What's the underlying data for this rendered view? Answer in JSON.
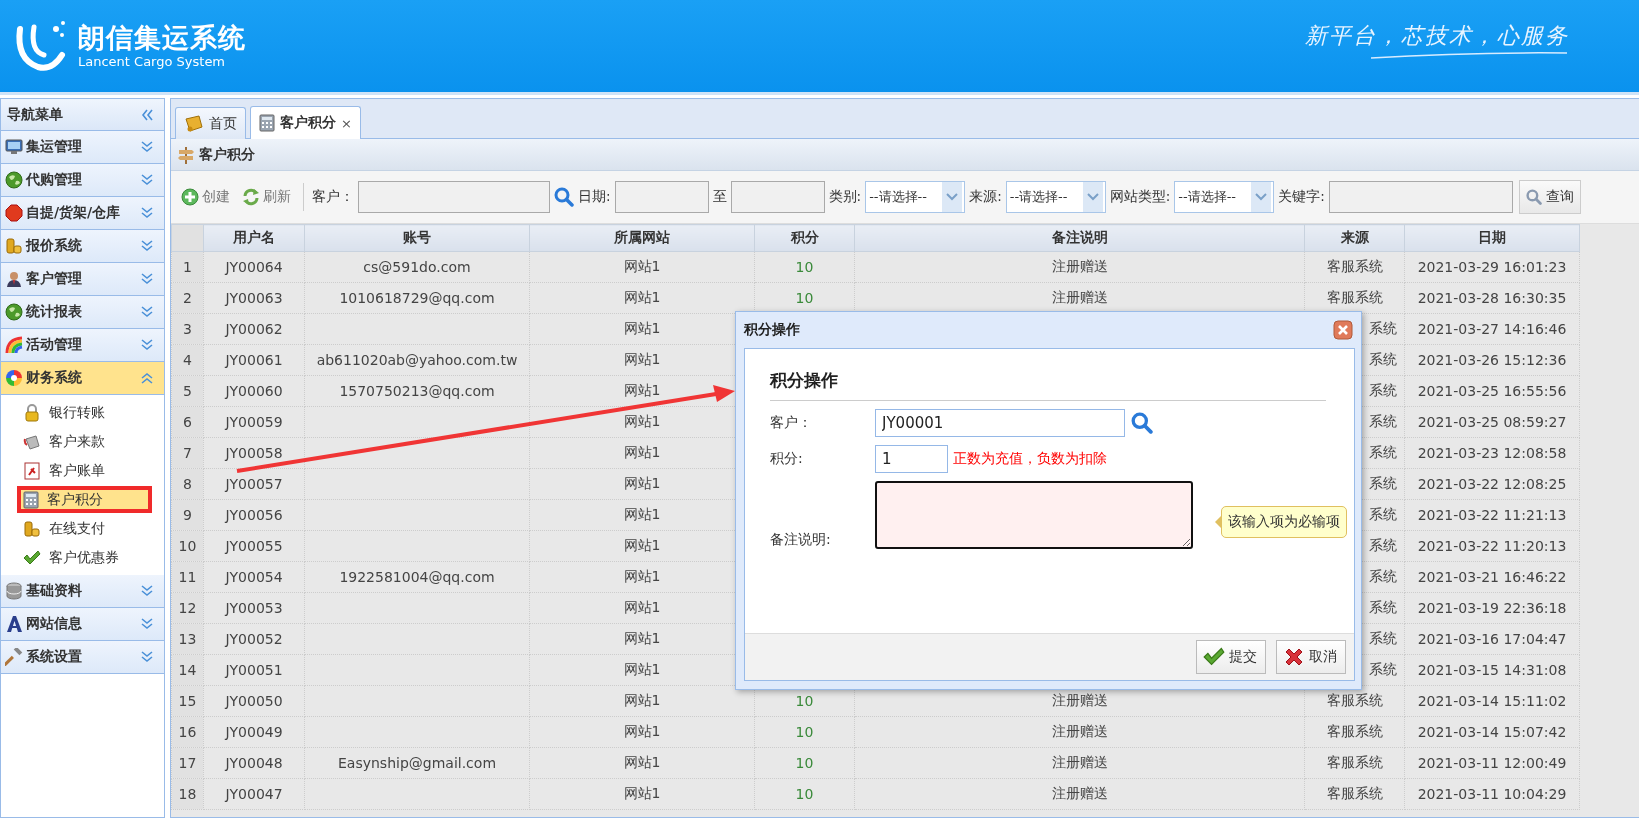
{
  "header": {
    "title": "朗信集运系统",
    "subtitle": "Lancent Cargo System",
    "slogan": "新平台，芯技术，心服务"
  },
  "sidebar": {
    "title": "导航菜单",
    "groups": [
      {
        "label": "集运管理",
        "expanded": false
      },
      {
        "label": "代购管理",
        "expanded": false
      },
      {
        "label": "自提/货架/仓库",
        "expanded": false
      },
      {
        "label": "报价系统",
        "expanded": false
      },
      {
        "label": "客户管理",
        "expanded": false
      },
      {
        "label": "统计报表",
        "expanded": false
      },
      {
        "label": "活动管理",
        "expanded": false
      },
      {
        "label": "财务系统",
        "expanded": true,
        "children": [
          {
            "label": "银行转账",
            "selected": false,
            "highlighted": false
          },
          {
            "label": "客户来款",
            "selected": false,
            "highlighted": false
          },
          {
            "label": "客户账单",
            "selected": false,
            "highlighted": false
          },
          {
            "label": "客户积分",
            "selected": true,
            "highlighted": true
          },
          {
            "label": "在线支付",
            "selected": false,
            "highlighted": false
          },
          {
            "label": "客户优惠券",
            "selected": false,
            "highlighted": false
          }
        ]
      },
      {
        "label": "基础资料",
        "expanded": false
      },
      {
        "label": "网站信息",
        "expanded": false
      },
      {
        "label": "系统设置",
        "expanded": false
      }
    ]
  },
  "tabs": [
    {
      "label": "首页",
      "selected": false
    },
    {
      "label": "客户积分",
      "selected": true,
      "close": "×"
    }
  ],
  "panel": {
    "title": "客户积分"
  },
  "toolbar": {
    "buttons": [
      {
        "label": "创建"
      },
      {
        "label": "刷新"
      }
    ],
    "filters": [
      {
        "kind": "field",
        "label": "客户：",
        "lookup": true
      },
      {
        "kind": "field",
        "label": "日期:",
        "lookup": false
      },
      {
        "kind": "field",
        "label": "至",
        "lookup": false
      },
      {
        "kind": "select",
        "label": "类别:",
        "value": "--请选择--"
      },
      {
        "kind": "select",
        "label": "来源:",
        "value": "--请选择--"
      },
      {
        "kind": "select",
        "label": "网站类型:",
        "value": "--请选择--"
      },
      {
        "kind": "field",
        "label": "关键字:",
        "lookup": false
      }
    ],
    "search_button": {
      "label": "查询"
    }
  },
  "table": {
    "columns": [
      "用户名",
      "账号",
      "所属网站",
      "积分",
      "备注说明",
      "来源",
      "日期"
    ],
    "rows": [
      {
        "no": "1",
        "user": "JY00064",
        "account": "cs@591do.com",
        "site": "网站1",
        "score": "10",
        "note": "注册赠送",
        "source": "客服系统",
        "date": "2021-03-29 16:01:23"
      },
      {
        "no": "2",
        "user": "JY00063",
        "account": "1010618729@qq.com",
        "site": "网站1",
        "score": "10",
        "note": "注册赠送",
        "source": "客服系统",
        "date": "2021-03-28 16:30:35"
      },
      {
        "no": "3",
        "user": "JY00062",
        "site": "网站1",
        "source": "系统",
        "date": "2021-03-27 14:16:46"
      },
      {
        "no": "4",
        "user": "JY00061",
        "account": "ab611020ab@yahoo.com.tw",
        "site": "网站1",
        "source": "系统",
        "date": "2021-03-26 15:12:36"
      },
      {
        "no": "5",
        "user": "JY00060",
        "account": "1570750213@qq.com",
        "site": "网站1",
        "source": "系统",
        "date": "2021-03-25 16:55:56"
      },
      {
        "no": "6",
        "user": "JY00059",
        "site": "网站1",
        "source": "系统",
        "date": "2021-03-25 08:59:27"
      },
      {
        "no": "7",
        "user": "JY00058",
        "site": "网站1",
        "source": "系统",
        "date": "2021-03-23 12:08:58"
      },
      {
        "no": "8",
        "user": "JY00057",
        "site": "网站1",
        "source": "系统",
        "date": "2021-03-22 12:08:25"
      },
      {
        "no": "9",
        "user": "JY00056",
        "site": "网站1",
        "source": "系统",
        "date": "2021-03-22 11:21:13"
      },
      {
        "no": "10",
        "user": "JY00055",
        "site": "网站1",
        "source": "系统",
        "date": "2021-03-22 11:20:13"
      },
      {
        "no": "11",
        "user": "JY00054",
        "account": "1922581004@qq.com",
        "site": "网站1",
        "source": "系统",
        "date": "2021-03-21 16:46:22"
      },
      {
        "no": "12",
        "user": "JY00053",
        "site": "网站1",
        "source": "系统",
        "date": "2021-03-19 22:36:18"
      },
      {
        "no": "13",
        "user": "JY00052",
        "site": "网站1",
        "source": "系统",
        "date": "2021-03-16 17:04:47"
      },
      {
        "no": "14",
        "user": "JY00051",
        "site": "网站1",
        "source": "系统",
        "date": "2021-03-15 14:31:08"
      },
      {
        "no": "15",
        "user": "JY00050",
        "site": "网站1",
        "score": "10",
        "note": "注册赠送",
        "source": "客服系统",
        "date": "2021-03-14 15:11:02"
      },
      {
        "no": "16",
        "user": "JY00049",
        "site": "网站1",
        "score": "10",
        "note": "注册赠送",
        "source": "客服系统",
        "date": "2021-03-14 15:07:42"
      },
      {
        "no": "17",
        "user": "JY00048",
        "account": "Easynship@gmail.com",
        "site": "网站1",
        "score": "10",
        "note": "注册赠送",
        "source": "客服系统",
        "date": "2021-03-11 12:00:49"
      },
      {
        "no": "18",
        "user": "JY00047",
        "site": "网站1",
        "score": "10",
        "note": "注册赠送",
        "source": "客服系统",
        "date": "2021-03-11 10:04:29"
      }
    ]
  },
  "dialog": {
    "title": "积分操作",
    "heading": "积分操作",
    "fields": [
      {
        "kind": "lookup",
        "label": "客户：",
        "value": "JY00001"
      },
      {
        "kind": "number",
        "label": "积分:",
        "value": "1",
        "hint": "正数为充值，负数为扣除"
      },
      {
        "kind": "textarea",
        "label": "备注说明:",
        "invalid": true,
        "tooltip": "该输入项为必输项"
      }
    ],
    "buttons": [
      {
        "kind": "submit",
        "label": "提交"
      },
      {
        "kind": "cancel",
        "label": "取消"
      }
    ]
  }
}
